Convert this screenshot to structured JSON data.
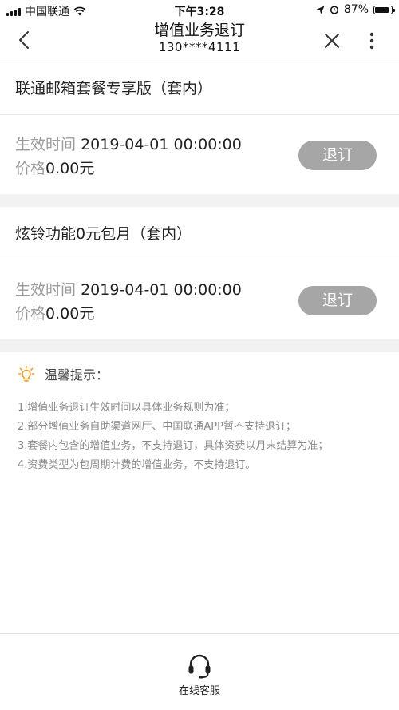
{
  "status_bar": {
    "carrier": "中国联通",
    "time": "下午3:28",
    "battery": "87%",
    "battery_level": 0.87
  },
  "nav": {
    "title": "增值业务退订",
    "subtitle": "130****4111"
  },
  "services": [
    {
      "name": "联通邮箱套餐专享版（套内）",
      "effective_label": "生效时间",
      "effective_time": "2019-04-01 00:00:00",
      "price_label": "价格",
      "price": "0.00元",
      "button": "退订"
    },
    {
      "name": "炫铃功能0元包月（套内）",
      "effective_label": "生效时间",
      "effective_time": "2019-04-01 00:00:00",
      "price_label": "价格",
      "price": "0.00元",
      "button": "退订"
    }
  ],
  "tips": {
    "title": "温馨提示：",
    "items": [
      "1.增值业务退订生效时间以具体业务规则为准；",
      "2.部分增值业务自助渠道网厅、中国联通APP暂不支持退订；",
      "3.套餐内包含的增值业务，不支持退订，具体资费以月末结算为准；",
      "4.资费类型为包周期计费的增值业务，不支持退订。"
    ]
  },
  "bottom": {
    "service_label": "在线客服"
  },
  "colors": {
    "button_bg": "#a6a6a6",
    "tip_icon": "#f39c2c",
    "divider_bg": "#f2f2f2"
  },
  "icons": {
    "back": "chevron-left-icon",
    "close": "close-icon",
    "more": "more-vertical-icon",
    "tip": "lightbulb-icon",
    "service": "headset-icon"
  }
}
